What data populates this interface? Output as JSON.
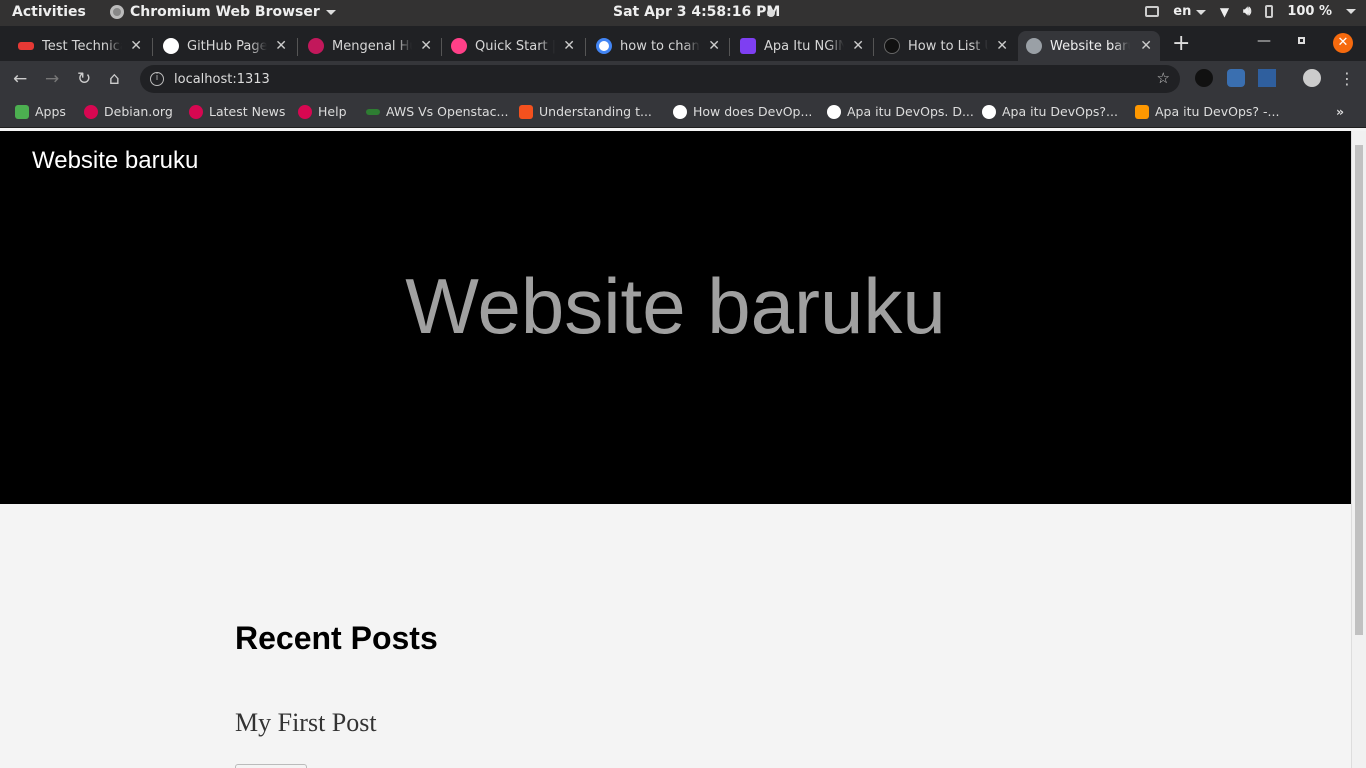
{
  "system_bar": {
    "activities": "Activities",
    "app_name": "Chromium Web Browser",
    "clock": "Sat Apr 3   4:58:16 PM",
    "language": "en",
    "battery": "100 %"
  },
  "tabs": [
    {
      "title": "Test Technical",
      "color": "#e53935"
    },
    {
      "title": "GitHub Pages",
      "color": "#ffffff"
    },
    {
      "title": "Mengenal Hugo",
      "color": "#c2185b"
    },
    {
      "title": "Quick Start | Hugo",
      "color": "#ff4088"
    },
    {
      "title": "how to change",
      "color": "#4285f4"
    },
    {
      "title": "Apa Itu NGINX",
      "color": "#7e3ff2"
    },
    {
      "title": "How to List Users",
      "color": "#111111"
    },
    {
      "title": "Website baruku",
      "color": "#9aa0a6"
    }
  ],
  "toolbar": {
    "url": "localhost:1313"
  },
  "bookmarks": [
    {
      "label": "Apps",
      "color": "#4caf50"
    },
    {
      "label": "Debian.org",
      "color": "#d70751"
    },
    {
      "label": "Latest News",
      "color": "#d70751"
    },
    {
      "label": "Help",
      "color": "#d70751"
    },
    {
      "label": "AWS Vs Openstac...",
      "color": "#2e7d32"
    },
    {
      "label": "Understanding t...",
      "color": "#f4511e"
    },
    {
      "label": "How does DevOp...",
      "color": "#ffffff"
    },
    {
      "label": "Apa itu DevOps. D...",
      "color": "#ffffff"
    },
    {
      "label": "Apa itu DevOps?...",
      "color": "#ffffff"
    },
    {
      "label": "Apa itu DevOps? -...",
      "color": "#ff9800"
    }
  ],
  "page": {
    "site_name": "Website baruku",
    "hero_title": "Website baruku",
    "section_heading": "Recent Posts",
    "posts": [
      {
        "title": "My First Post"
      }
    ]
  }
}
